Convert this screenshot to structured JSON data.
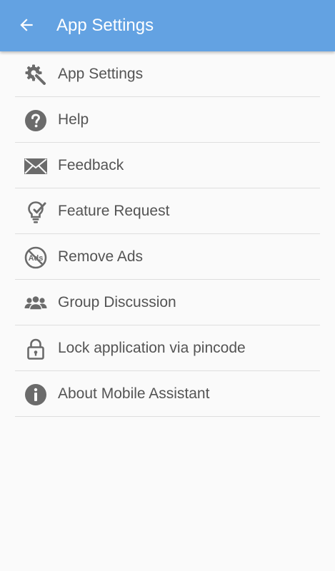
{
  "app_bar": {
    "title": "App Settings",
    "back_icon": "arrow-back-icon",
    "color": "#63a2e2"
  },
  "menu": {
    "items": [
      {
        "label": "App Settings",
        "icon": "gear-wrench-icon"
      },
      {
        "label": "Help",
        "icon": "help-circle-icon"
      },
      {
        "label": "Feedback",
        "icon": "envelope-icon"
      },
      {
        "label": "Feature Request",
        "icon": "lightbulb-check-icon"
      },
      {
        "label": "Remove Ads",
        "icon": "no-ads-icon"
      },
      {
        "label": "Group Discussion",
        "icon": "group-icon"
      },
      {
        "label": "Lock application via pincode",
        "icon": "padlock-icon"
      },
      {
        "label": "About Mobile Assistant",
        "icon": "info-circle-icon"
      }
    ]
  },
  "colors": {
    "icon": "#6b6b6b",
    "text": "#545454",
    "background": "#fafafa",
    "divider": "#dedede"
  }
}
